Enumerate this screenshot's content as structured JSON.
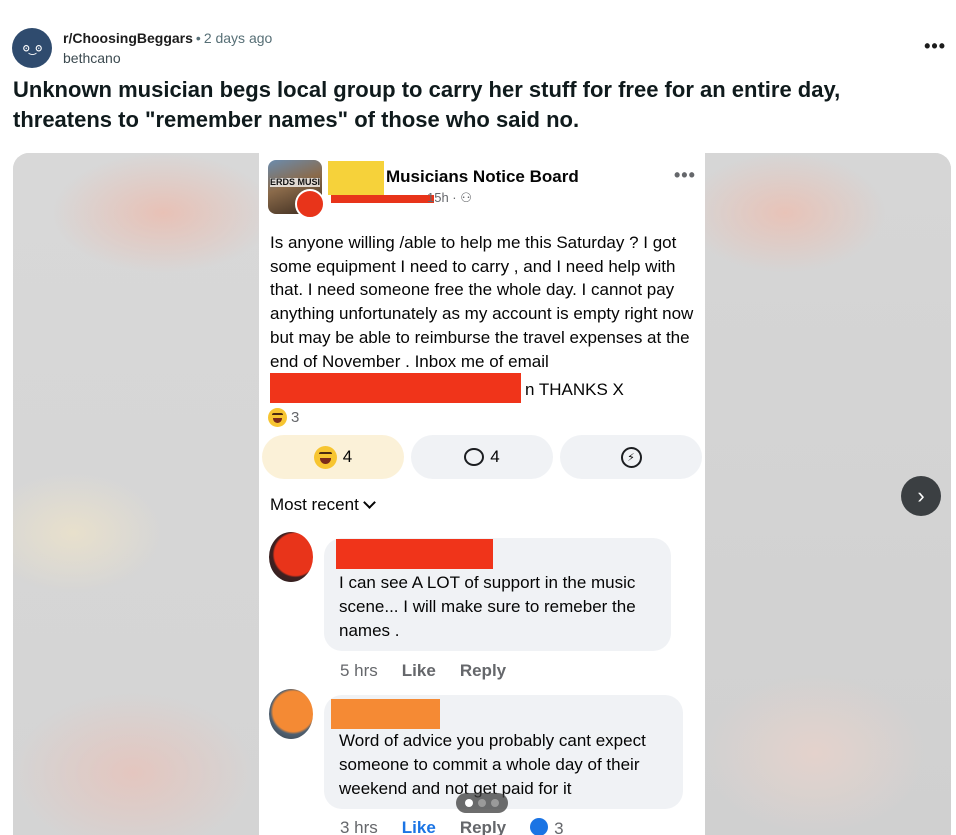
{
  "post": {
    "avatar_text": "ʘ‿ʘ",
    "subreddit": "r/ChoosingBeggars",
    "separator": "•",
    "time": "2 days ago",
    "username": "bethcano",
    "more_label": "•••",
    "title": "Unknown musician begs local group to carry her stuff for free for an entire day, threatens to \"remember names\" of those who said no."
  },
  "fb": {
    "group_icon_text": "ERDS MUSICIAN NOTICE",
    "group_name": "Musicians Notice Board",
    "meta": "15h ·",
    "more_label": "•••",
    "body_main": "Is anyone willing /able to help me this Saturday ? I got some equipment I need to carry , and I need help with that.  I need someone free the whole day. I cannot pay anything unfortunately as my account is empty right now but may be able to reimburse the travel expenses  at the end of November . Inbox me of email",
    "body_end": "n  THANKS X",
    "reaction_count": "3",
    "react_btn_count": "4",
    "comment_btn_count": "4",
    "messenger_glyph": "⚡",
    "sort_label": "Most recent",
    "comments": [
      {
        "text": "I can see A LOT of support in the music scene... I will make sure to remeber the names .",
        "time": "5 hrs",
        "like": "Like",
        "reply": "Reply"
      },
      {
        "text": "Word of advice you probably cant expect someone to commit a whole day of their weekend and not get paid for it",
        "time": "3 hrs",
        "like": "Like",
        "reply": "Reply",
        "likes": "3"
      }
    ]
  },
  "carousel": {
    "next_label": "›",
    "pages": 3,
    "current": 1
  },
  "colors": {
    "redact_red": "#f0341a",
    "redact_orange": "#f58a34",
    "redact_yellow": "#f6d23a",
    "subreddit_avatar": "#2f4b6e"
  }
}
